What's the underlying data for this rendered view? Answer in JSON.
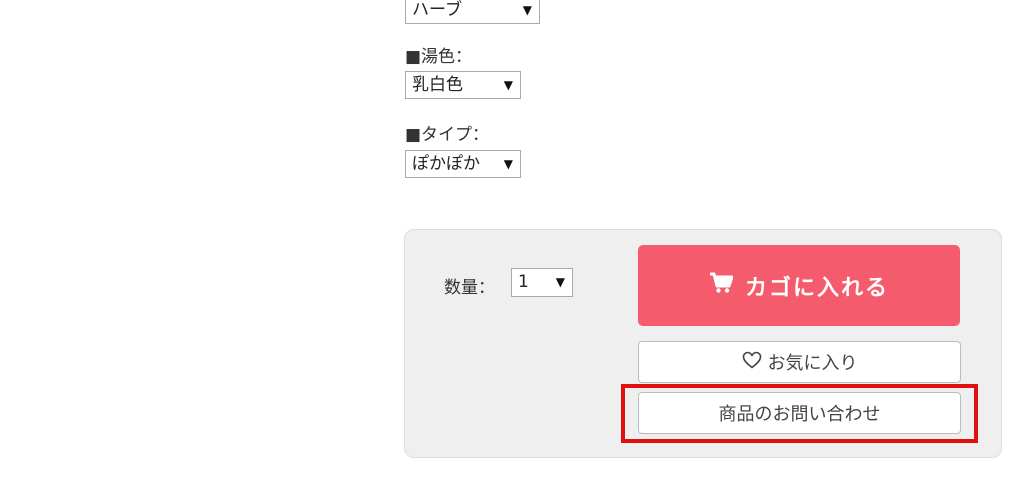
{
  "options": {
    "kind_value": "ハーブ",
    "color_label": "■湯色：",
    "color_value": "乳白色",
    "type_label": "■タイプ：",
    "type_value": "ぽかぽか",
    "dropdown_arrow": "▼"
  },
  "purchase": {
    "quantity_label": "数量：",
    "quantity_value": "1",
    "add_to_cart_label": "カゴに入れる",
    "favorite_label": "お気に入り",
    "inquiry_label": "商品のお問い合わせ",
    "icons": [
      "cart-icon",
      "heart-icon"
    ],
    "colors": {
      "cart_button": "#f45c6d",
      "panel": "#efefef",
      "highlight": "#e01010"
    }
  }
}
